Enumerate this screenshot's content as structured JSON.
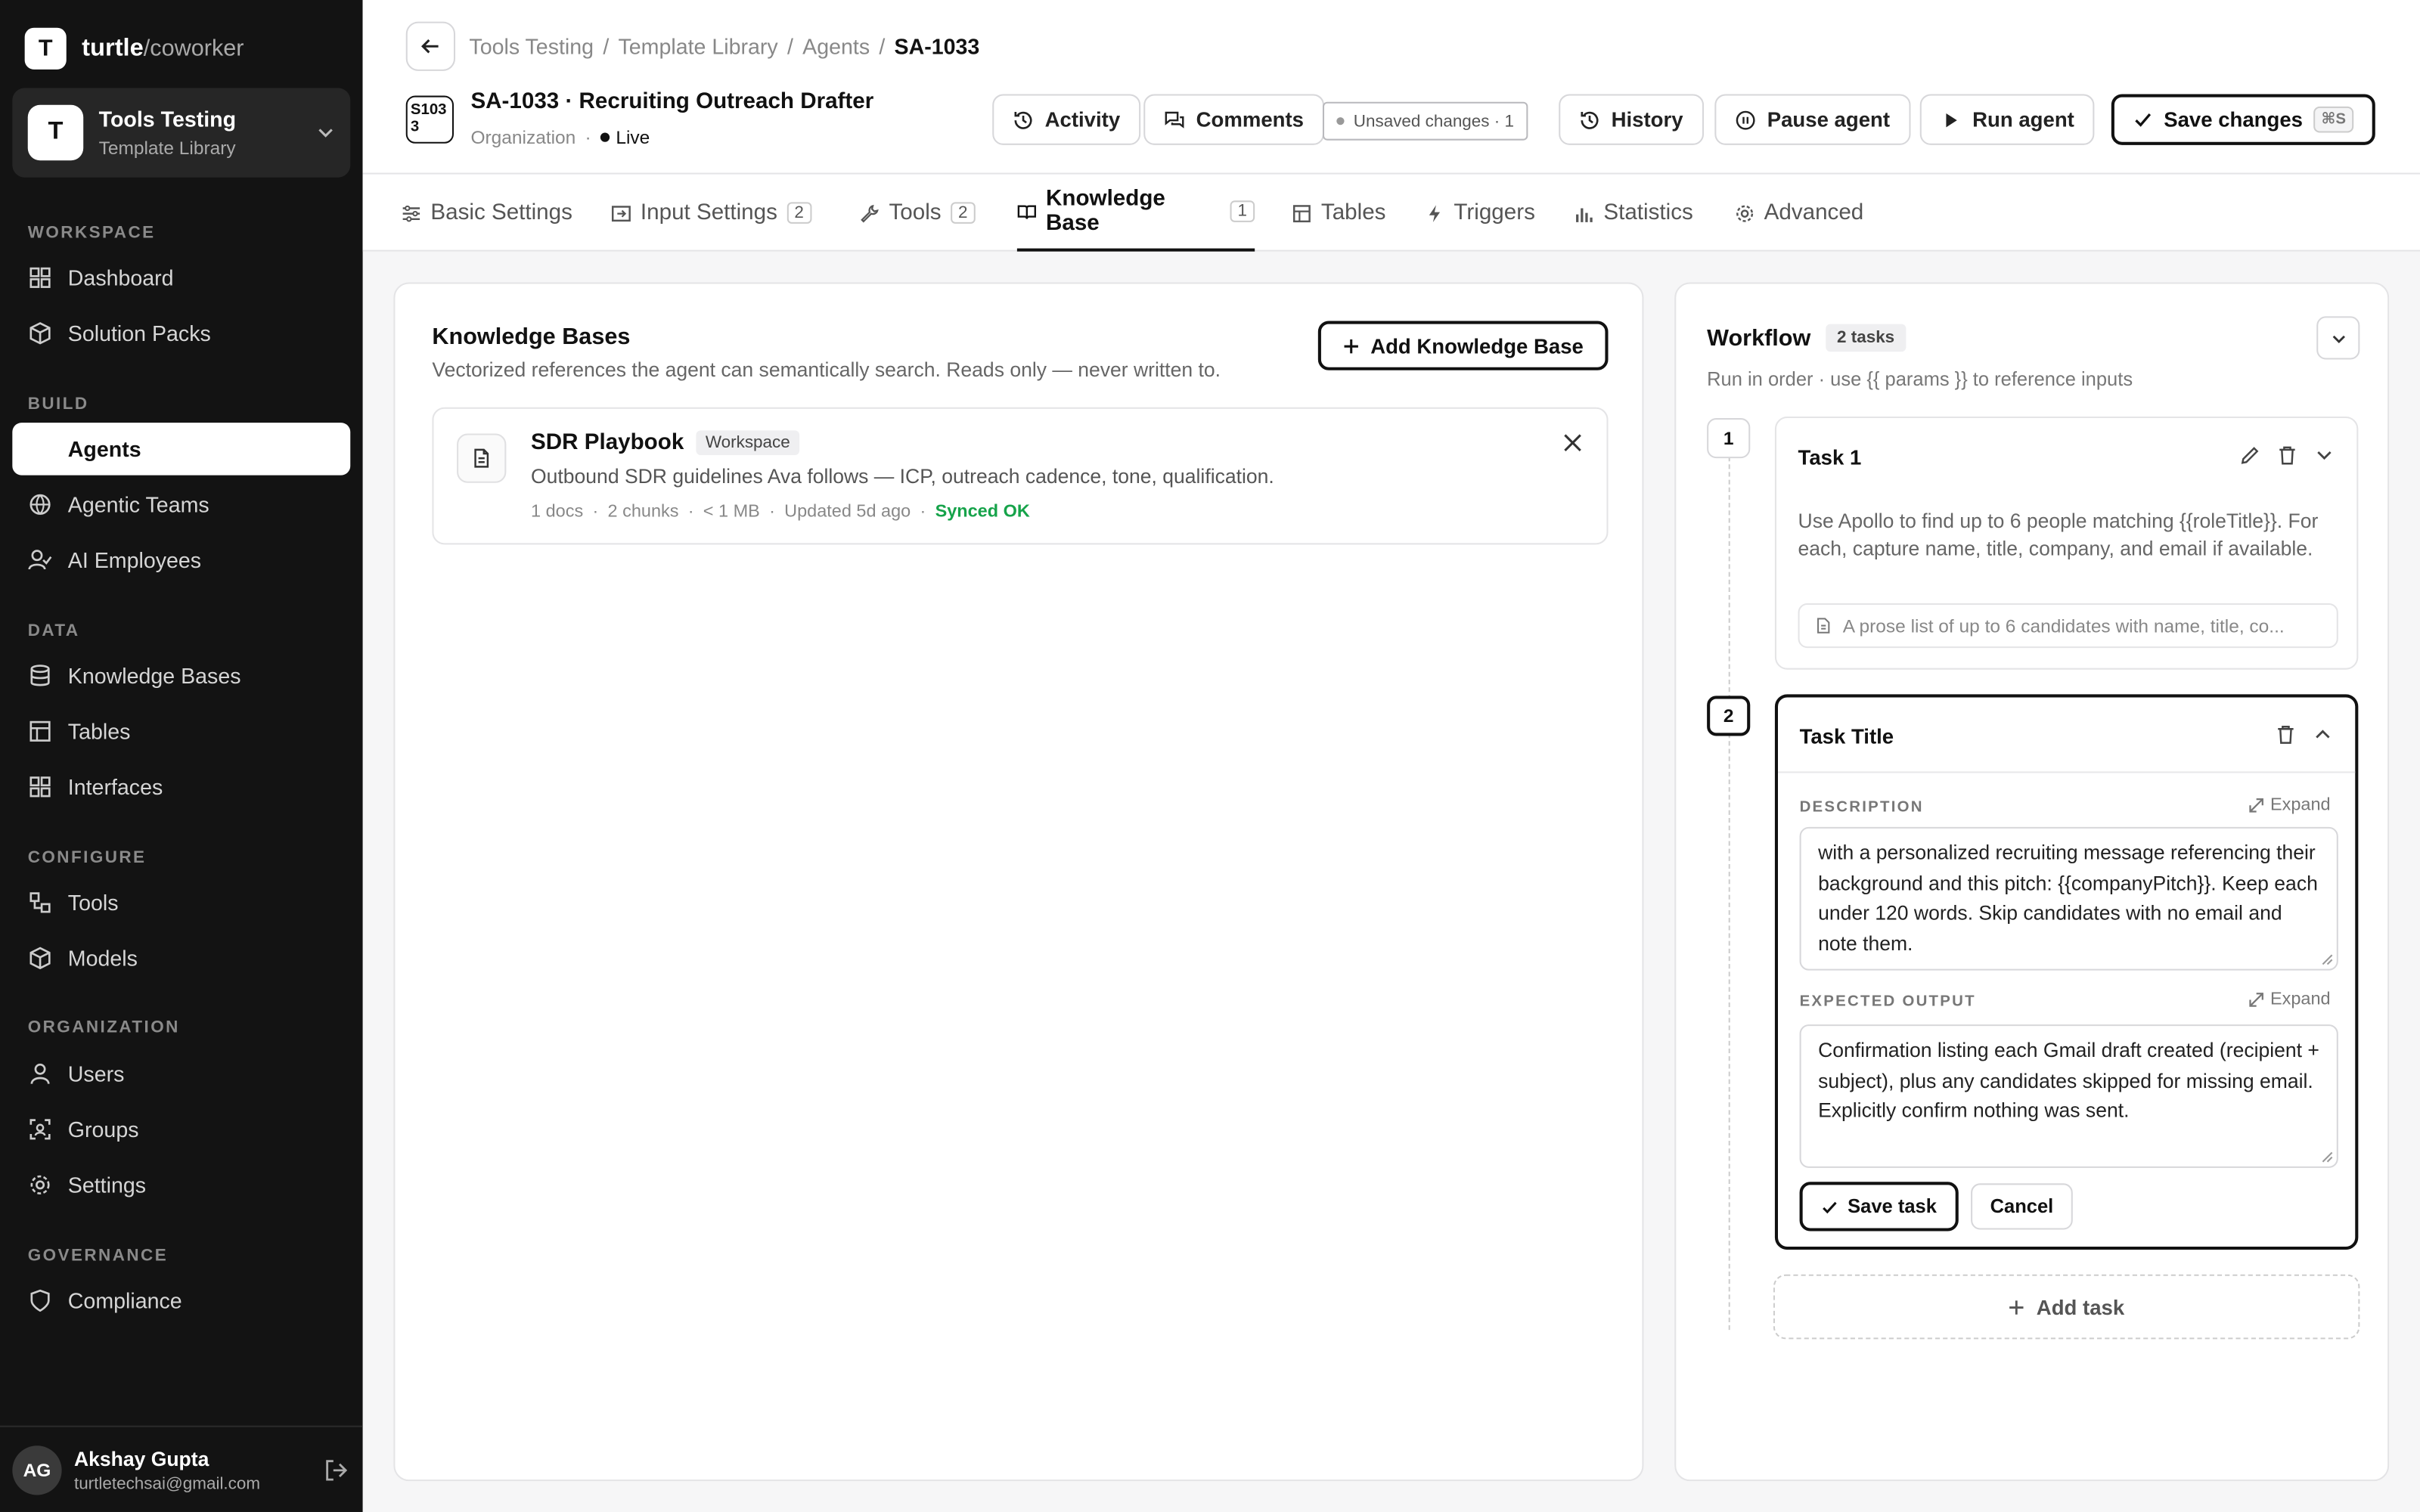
{
  "brand": {
    "logo_letter": "T",
    "name": "turtle",
    "suffix": "/coworker"
  },
  "workspace": {
    "avatar": "T",
    "title": "Tools Testing",
    "subtitle": "Template Library"
  },
  "nav": {
    "sections": {
      "workspace": "WORKSPACE",
      "build": "BUILD",
      "data": "DATA",
      "configure": "CONFIGURE",
      "organization": "ORGANIZATION",
      "governance": "GOVERNANCE"
    },
    "items": {
      "dashboard": "Dashboard",
      "solution_packs": "Solution Packs",
      "agents": "Agents",
      "agentic_teams": "Agentic Teams",
      "ai_employees": "AI Employees",
      "knowledge_bases": "Knowledge Bases",
      "tables": "Tables",
      "interfaces": "Interfaces",
      "tools": "Tools",
      "models": "Models",
      "users": "Users",
      "groups": "Groups",
      "settings": "Settings",
      "compliance": "Compliance"
    }
  },
  "user": {
    "initials": "AG",
    "name": "Akshay Gupta",
    "email": "turtletechsai@gmail.com"
  },
  "breadcrumb": {
    "c1": "Tools Testing",
    "c2": "Template Library",
    "c3": "Agents",
    "current": "SA-1033",
    "sep": "/"
  },
  "agent": {
    "id_box": "S1033",
    "title": "SA-1033 · Recruiting Outreach Drafter",
    "scope": "Organization",
    "status": "Live"
  },
  "header_buttons": {
    "activity": "Activity",
    "comments": "Comments",
    "unsaved": "Unsaved changes · 1",
    "history": "History",
    "pause": "Pause agent",
    "run": "Run agent",
    "save": "Save changes",
    "save_kbd": "⌘S"
  },
  "tabs": {
    "basic": "Basic Settings",
    "input": "Input Settings",
    "input_count": "2",
    "tools": "Tools",
    "tools_count": "2",
    "kb": "Knowledge Base",
    "kb_count": "1",
    "tables": "Tables",
    "triggers": "Triggers",
    "statistics": "Statistics",
    "advanced": "Advanced"
  },
  "knowledge": {
    "title": "Knowledge Bases",
    "subtitle": "Vectorized references the agent can semantically search. Reads only — never written to.",
    "add_label": "Add Knowledge Base",
    "card": {
      "name": "SDR Playbook",
      "badge": "Workspace",
      "description": "Outbound SDR guidelines Ava follows — ICP, outreach cadence, tone, qualification.",
      "docs": "1 docs",
      "chunks": "2 chunks",
      "size": "< 1 MB",
      "updated": "Updated 5d ago",
      "sync": "Synced OK",
      "dot": "·"
    }
  },
  "workflow": {
    "title": "Workflow",
    "badge": "2 tasks",
    "subtitle": "Run in order · use {{ params }} to reference inputs",
    "task1": {
      "num": "1",
      "name": "Task 1",
      "description": "Use Apollo to find up to 6 people matching {{roleTitle}}. For each, capture name, title, company, and email if available.",
      "output": "A prose list of up to 6 candidates with name, title, co..."
    },
    "task2": {
      "num": "2",
      "name": "Task Title",
      "desc_label": "DESCRIPTION",
      "expand": "Expand",
      "description": "with a personalized recruiting message referencing their background and this pitch: {{companyPitch}}. Keep each under 120 words. Skip candidates with no email and note them.",
      "output_label": "EXPECTED OUTPUT",
      "output": "Confirmation listing each Gmail draft created (recipient + subject), plus any candidates skipped for missing email. Explicitly confirm nothing was sent.",
      "save_label": "Save task",
      "cancel_label": "Cancel"
    },
    "add_task": "Add task"
  }
}
